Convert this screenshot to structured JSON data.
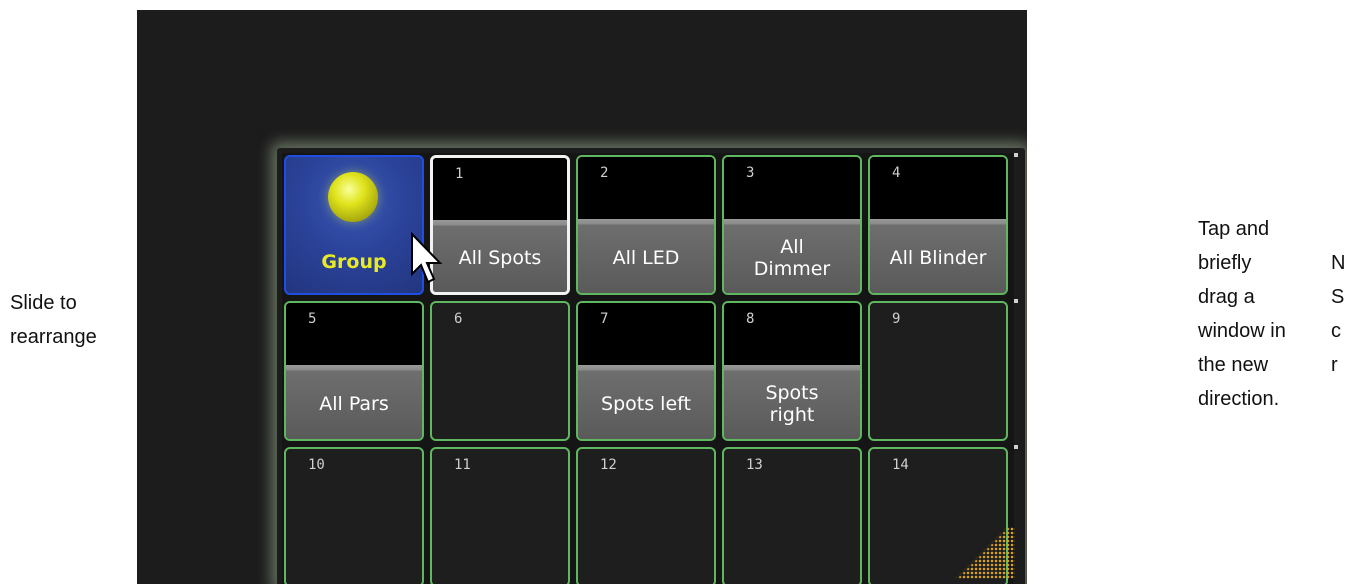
{
  "captions": {
    "left": "Slide to rearrange",
    "right": [
      "Tap and",
      "briefly",
      "drag a",
      "window in",
      "the new",
      "direction."
    ],
    "cut_column": [
      "N",
      "S",
      "c",
      "r"
    ]
  },
  "pool": {
    "group_label": "Group",
    "cells": [
      {
        "num": "1",
        "label": "All Spots"
      },
      {
        "num": "2",
        "label": "All LED"
      },
      {
        "num": "3",
        "label": "All Dimmer"
      },
      {
        "num": "4",
        "label": "All Blinder"
      },
      {
        "num": "5",
        "label": "All Pars"
      },
      {
        "num": "6",
        "label": ""
      },
      {
        "num": "7",
        "label": "Spots left"
      },
      {
        "num": "8",
        "label": "Spots right"
      },
      {
        "num": "9",
        "label": ""
      },
      {
        "num": "10",
        "label": ""
      },
      {
        "num": "11",
        "label": ""
      },
      {
        "num": "12",
        "label": ""
      },
      {
        "num": "13",
        "label": ""
      },
      {
        "num": "14",
        "label": ""
      }
    ]
  },
  "colors": {
    "border_green": "#5fb85f",
    "group_blue": "#2b439a",
    "group_text": "#e8ea26",
    "highlight": "#d9a21b"
  }
}
